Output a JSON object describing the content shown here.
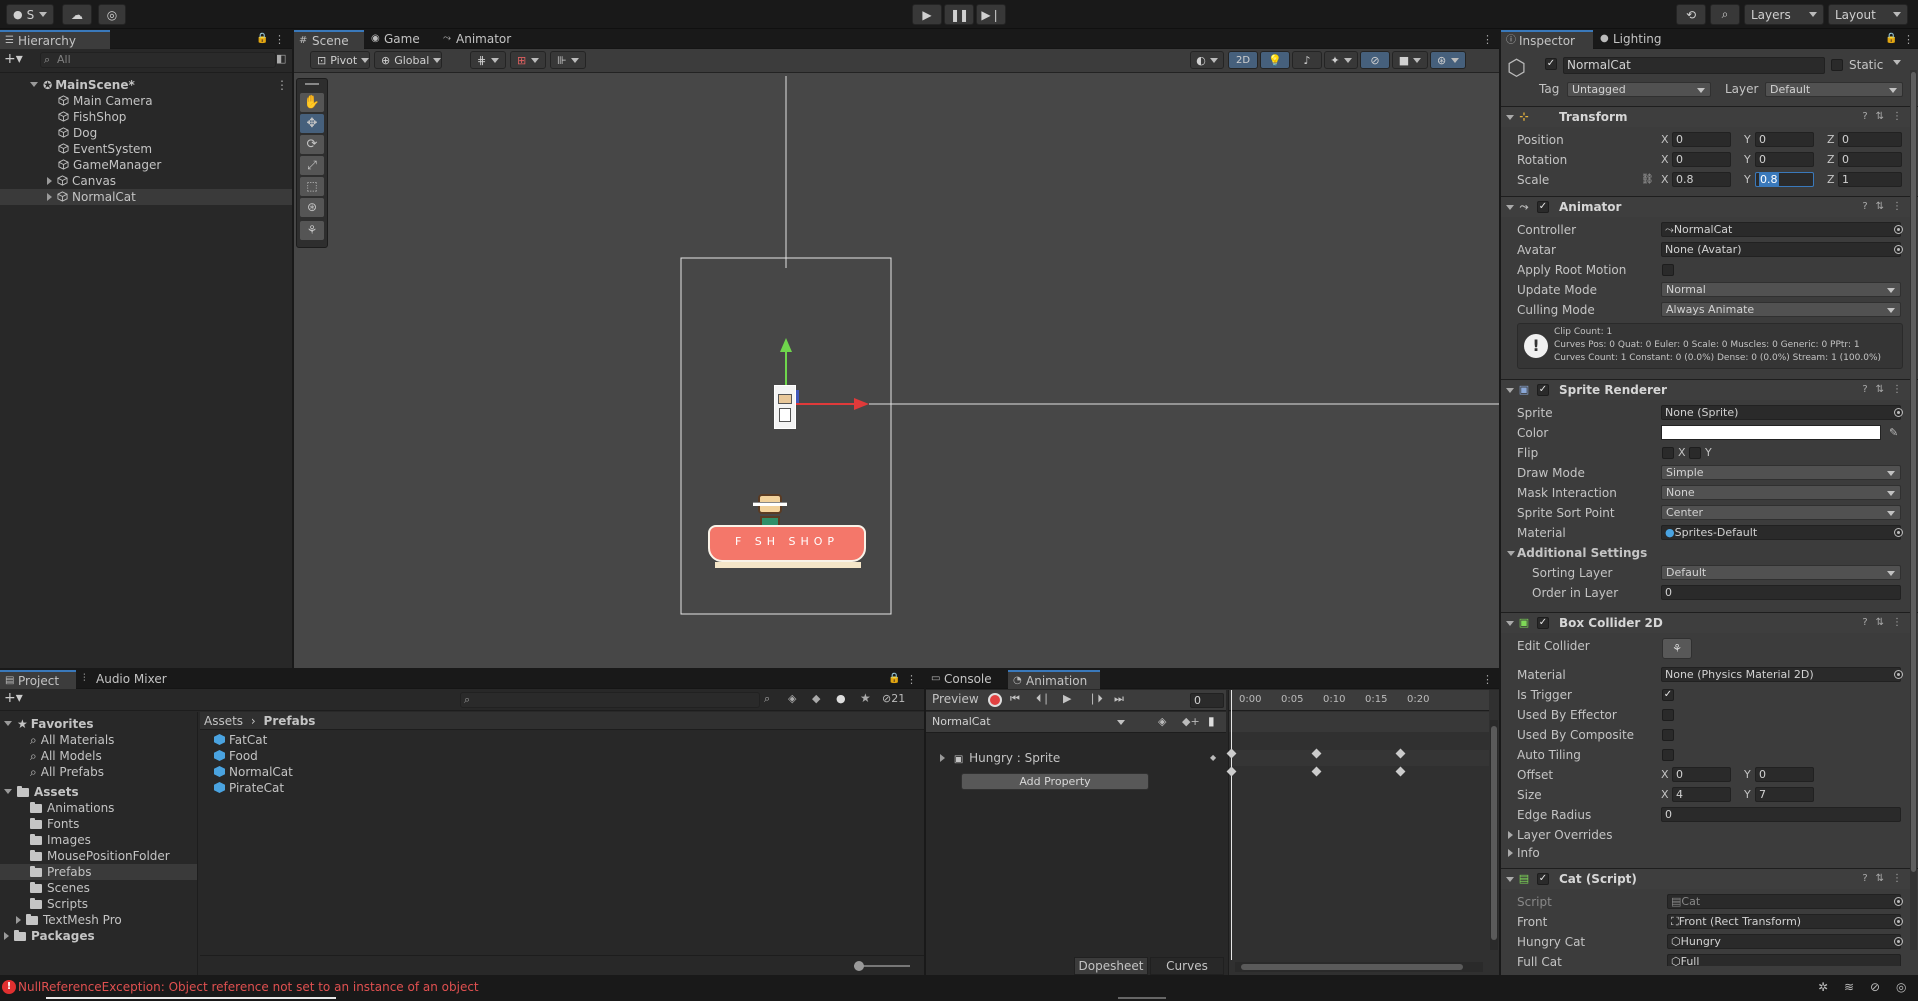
{
  "topbar": {
    "account_label": "S",
    "layers_label": "Layers",
    "layout_label": "Layout"
  },
  "hierarchy": {
    "tab": "Hierarchy",
    "search_placeholder": "All",
    "scene": "MainScene*",
    "items": [
      "Main Camera",
      "FishShop",
      "Dog",
      "EventSystem",
      "GameManager",
      "Canvas",
      "NormalCat"
    ]
  },
  "scene_view": {
    "tabs": [
      "Scene",
      "Game",
      "Animator"
    ],
    "pivot": "Pivot",
    "global": "Global",
    "mode_2d": "2D",
    "shop_sign": "F SH  SHOP"
  },
  "project": {
    "tabs": [
      "Project",
      "Audio Mixer"
    ],
    "hidden_count": "21",
    "favorites_label": "Favorites",
    "favorites": [
      "All Materials",
      "All Models",
      "All Prefabs"
    ],
    "assets_label": "Assets",
    "asset_folders": [
      "Animations",
      "Fonts",
      "Images",
      "MousePositionFolder",
      "Prefabs",
      "Scenes",
      "Scripts",
      "TextMesh Pro"
    ],
    "packages_label": "Packages",
    "breadcrumb": [
      "Assets",
      "Prefabs"
    ],
    "files": [
      "FatCat",
      "Food",
      "NormalCat",
      "PirateCat"
    ]
  },
  "animation": {
    "tabs": [
      "Console",
      "Animation"
    ],
    "preview_label": "Preview",
    "frame": "0",
    "clip": "NormalCat",
    "property": "Hungry : Sprite",
    "add_property": "Add Property",
    "ruler": [
      "0:00",
      "0:05",
      "0:10",
      "0:15",
      "0:20"
    ],
    "dopesheet": "Dopesheet",
    "curves": "Curves"
  },
  "inspector": {
    "tabs": [
      "Inspector",
      "Lighting"
    ],
    "object_name": "NormalCat",
    "static_label": "Static",
    "tag_label": "Tag",
    "tag_value": "Untagged",
    "layer_label": "Layer",
    "layer_value": "Default",
    "transform": {
      "title": "Transform",
      "position_label": "Position",
      "rotation_label": "Rotation",
      "scale_label": "Scale",
      "position": [
        "0",
        "0",
        "0"
      ],
      "rotation": [
        "0",
        "0",
        "0"
      ],
      "scale": [
        "0.8",
        "0.8",
        "1"
      ]
    },
    "animator": {
      "title": "Animator",
      "controller_label": "Controller",
      "controller_value": "NormalCat",
      "avatar_label": "Avatar",
      "avatar_value": "None (Avatar)",
      "root_motion_label": "Apply Root Motion",
      "update_mode_label": "Update Mode",
      "update_mode_value": "Normal",
      "culling_label": "Culling Mode",
      "culling_value": "Always Animate",
      "info_lines": [
        "Clip Count: 1",
        "Curves Pos: 0 Quat: 0 Euler: 0 Scale: 0 Muscles: 0 Generic: 0 PPtr: 1",
        "Curves Count: 1 Constant: 0 (0.0%) Dense: 0 (0.0%) Stream: 1 (100.0%)"
      ]
    },
    "sprite_renderer": {
      "title": "Sprite Renderer",
      "sprite_label": "Sprite",
      "sprite_value": "None (Sprite)",
      "color_label": "Color",
      "color_value": "#ffffff",
      "flip_label": "Flip",
      "flip_x": "X",
      "flip_y": "Y",
      "draw_mode_label": "Draw Mode",
      "draw_mode_value": "Simple",
      "mask_label": "Mask Interaction",
      "mask_value": "None",
      "sort_point_label": "Sprite Sort Point",
      "sort_point_value": "Center",
      "material_label": "Material",
      "material_value": "Sprites-Default",
      "additional_label": "Additional Settings",
      "sorting_layer_label": "Sorting Layer",
      "sorting_layer_value": "Default",
      "order_label": "Order in Layer",
      "order_value": "0"
    },
    "box_collider": {
      "title": "Box Collider 2D",
      "edit_label": "Edit Collider",
      "material_label": "Material",
      "material_value": "None (Physics Material 2D)",
      "trigger_label": "Is Trigger",
      "effector_label": "Used By Effector",
      "composite_label": "Used By Composite",
      "tiling_label": "Auto Tiling",
      "offset_label": "Offset",
      "offset": [
        "0",
        "0"
      ],
      "size_label": "Size",
      "size": [
        "4",
        "7"
      ],
      "edge_label": "Edge Radius",
      "edge_value": "0",
      "layer_overrides_label": "Layer Overrides",
      "info_label": "Info"
    },
    "cat_script": {
      "title": "Cat (Script)",
      "script_label": "Script",
      "script_value": "Cat",
      "front_label": "Front",
      "front_value": "Front (Rect Transform)",
      "hungry_label": "Hungry Cat",
      "hungry_value": "Hungry",
      "full_label": "Full Cat",
      "full_value": "Full"
    }
  },
  "status": {
    "error": "NullReferenceException: Object reference not set to an instance of an object"
  }
}
